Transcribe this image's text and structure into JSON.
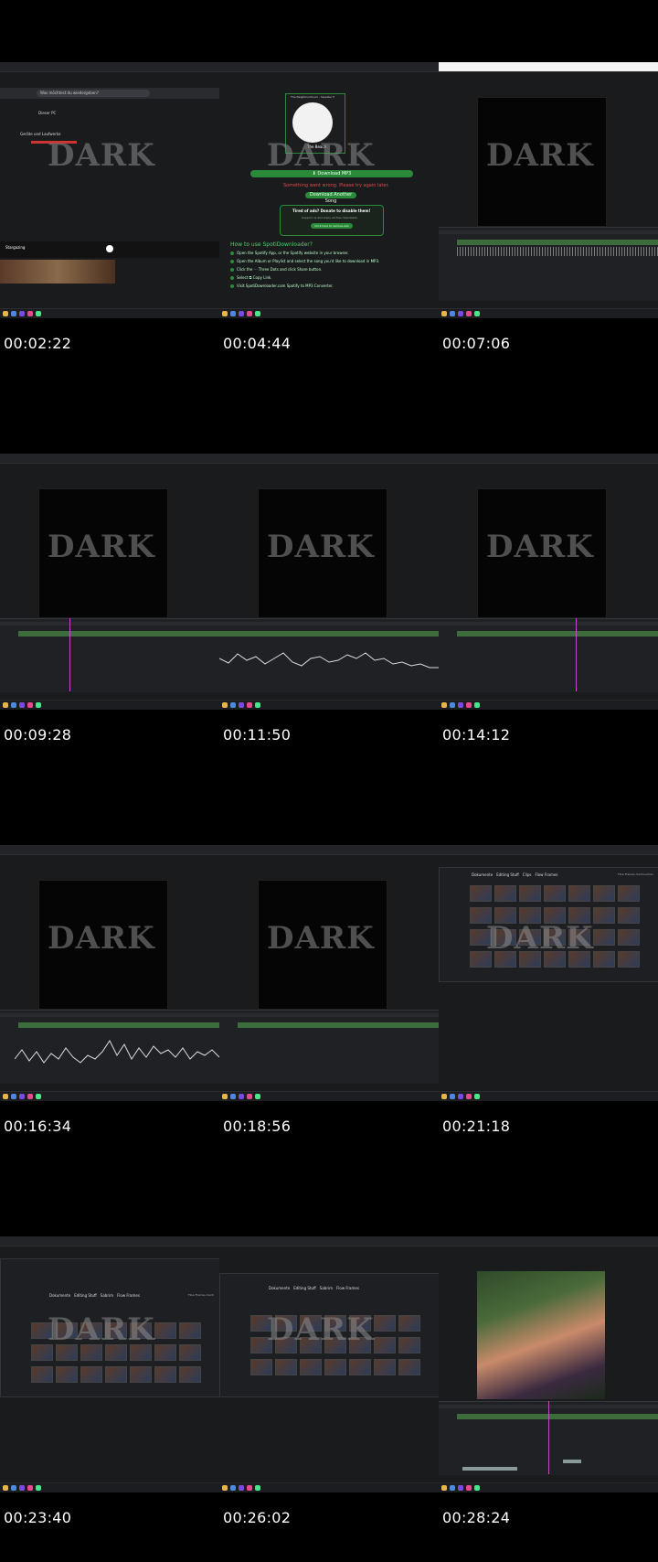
{
  "contact_sheet": {
    "watermark": "DARK",
    "frames": [
      {
        "timestamp": "00:02:22",
        "kind": "file-explorer",
        "search_placeholder": "Was möchtest du wiedergeben?",
        "folder_label": "Dieser PC",
        "panel_title": "Geräte und Laufwerke",
        "now_playing": "Stargazing"
      },
      {
        "timestamp": "00:04:44",
        "kind": "spotidownloader",
        "header": "The Neighbourhood – Sweater Weather",
        "track": "The Beach",
        "artist": "The Neighbourhood",
        "download_btn": "⬇ Download MP3",
        "error": "Something went wrong. Please try again later.",
        "another_btn": "Download Another Song",
        "donate_title": "Tired of ads? Donate to disable them!",
        "donate_sub": "Support us and enjoy ad-free downloads.",
        "donate_btn": "Click here to remove ads",
        "howto_title": "How to use SpotiDownloader?",
        "steps": [
          "Open the Spotify App, or the Spotify website in your browser.",
          "Open the Album or Playlist and select the song you'd like to download in MP3.",
          "Click the ⋯ Three Dots and click Share button.",
          "Select ⧉ Copy Link.",
          "Visit SpotiDownloader.com Spotify to MP3 Converter."
        ]
      },
      {
        "timestamp": "00:07:06",
        "kind": "editor"
      },
      {
        "timestamp": "00:09:28",
        "kind": "editor"
      },
      {
        "timestamp": "00:11:50",
        "kind": "editor"
      },
      {
        "timestamp": "00:14:12",
        "kind": "editor"
      },
      {
        "timestamp": "00:16:34",
        "kind": "editor"
      },
      {
        "timestamp": "00:18:56",
        "kind": "editor"
      },
      {
        "timestamp": "00:21:18",
        "kind": "explorer-thumbs",
        "breadcrumb": [
          "Dokumente",
          "Editing Stuff",
          "Clips",
          "Flow Frames"
        ],
        "search_placeholder": "Flow Frames durchsuchen"
      },
      {
        "timestamp": "00:23:40",
        "kind": "explorer-thumbs",
        "breadcrumb": [
          "Dokumente",
          "Editing Stuff",
          "Sabrim",
          "Flow Frames"
        ],
        "search_placeholder": "Flow Frames durch"
      },
      {
        "timestamp": "00:26:02",
        "kind": "explorer-thumbs",
        "breadcrumb": [
          "Dokumente",
          "Editing Stuff",
          "Sabrim",
          "Flow Frames"
        ],
        "search_placeholder": ""
      },
      {
        "timestamp": "00:28:24",
        "kind": "editor-image"
      }
    ]
  },
  "colors": {
    "accent_green": "#2a8a3a",
    "playhead": "#c24ac4",
    "error_red": "#e24a4a"
  }
}
